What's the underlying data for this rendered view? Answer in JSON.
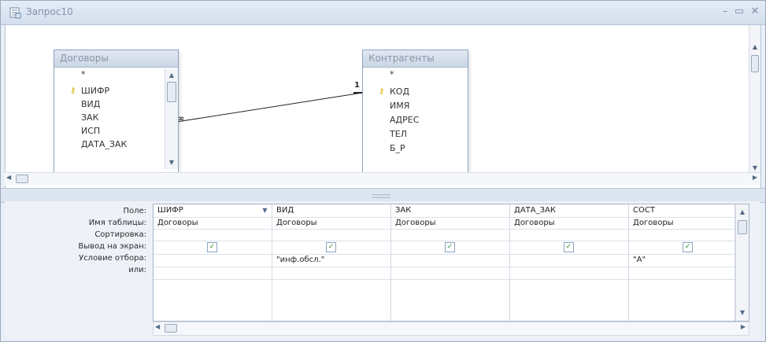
{
  "window": {
    "title": "Запрос10",
    "minimize": "–",
    "maximize": "▭",
    "close": "✕"
  },
  "tables": {
    "dogovory": {
      "title": "Договоры",
      "fields": [
        "*",
        "ШИФР",
        "ВИД",
        "ЗАК",
        "ИСП",
        "ДАТА_ЗАК"
      ]
    },
    "kontragenty": {
      "title": "Контрагенты",
      "fields": [
        "*",
        "КОД",
        "ИМЯ",
        "АДРЕС",
        "ТЕЛ",
        "Б_Р"
      ]
    }
  },
  "relation": {
    "many": "∞",
    "one": "1"
  },
  "grid_labels": {
    "field": "Поле:",
    "table": "Имя таблицы:",
    "sort": "Сортировка:",
    "show": "Вывод на экран:",
    "criteria": "Условие отбора:",
    "or": "или:"
  },
  "columns": [
    {
      "field": "ШИФР",
      "table": "Договоры",
      "show": true,
      "criteria": ""
    },
    {
      "field": "ВИД",
      "table": "Договоры",
      "show": true,
      "criteria": "\"инф.обсл.\""
    },
    {
      "field": "ЗАК",
      "table": "Договоры",
      "show": true,
      "criteria": ""
    },
    {
      "field": "ДАТА_ЗАК",
      "table": "Договоры",
      "show": true,
      "criteria": ""
    },
    {
      "field": "СОСТ",
      "table": "Договоры",
      "show": true,
      "criteria": "\"А\""
    }
  ],
  "icons": {
    "query": "query-icon",
    "key": "key-icon",
    "check": "✓"
  },
  "colors": {
    "title_text": "#8494a8",
    "key": "#d8b400",
    "check": "#2e8b2e"
  }
}
